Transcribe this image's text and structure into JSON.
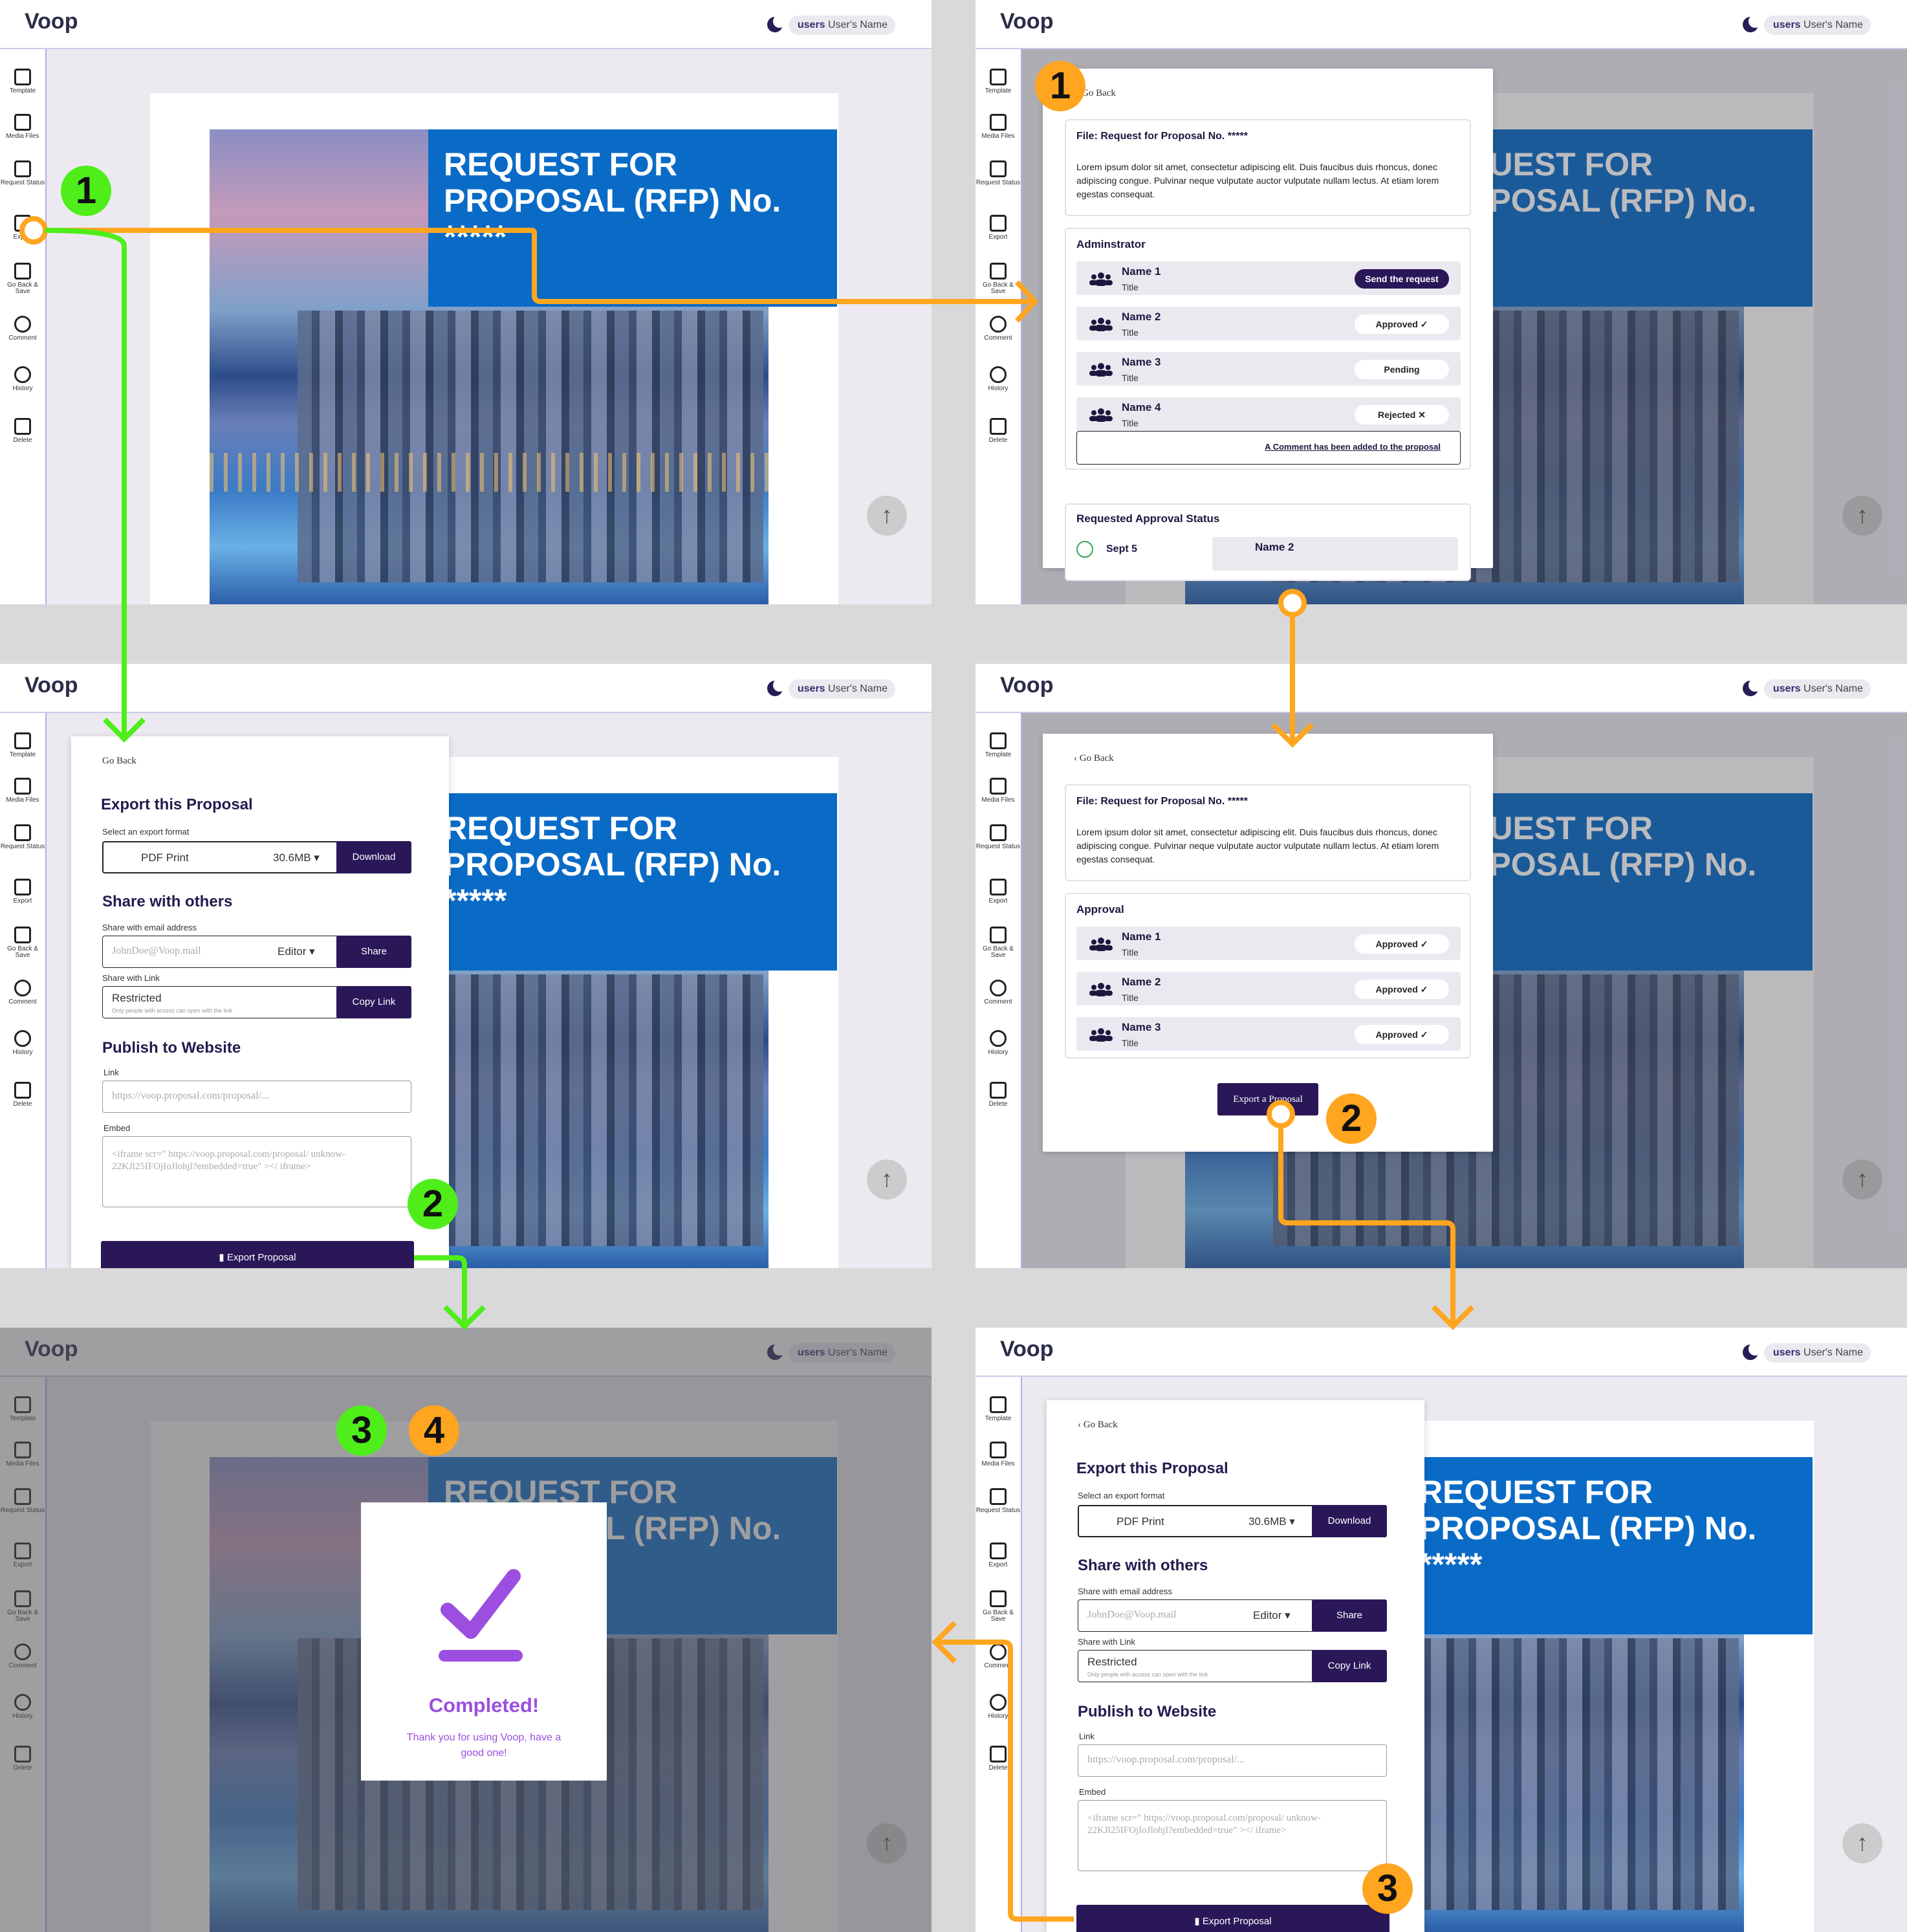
{
  "app": {
    "logo": "Voop",
    "user_prefix": "users",
    "user_name": "User's Name"
  },
  "sidebar": [
    "Template",
    "Media Files",
    "Request Status",
    "Export",
    "Go Back & Save",
    "Comment",
    "History",
    "Delete"
  ],
  "document": {
    "title": "REQUEST FOR PROPOSAL (RFP) No. *****",
    "title_partial": "UEST FOR POSAL (RFP) ****"
  },
  "request_status": {
    "go_back": "Go Back",
    "file_title": "File: Request for Proposal No. *****",
    "lorem": "Lorem ipsum dolor sit amet, consectetur adipiscing elit. Duis faucibus duis rhoncus, donec adipiscing congue. Pulvinar neque vulputate auctor vulputate nullam lectus. At etiam lorem egestas consequat.",
    "admin_heading": "Adminstrator",
    "rows": [
      {
        "name": "Name 1",
        "title": "Title",
        "status": "Send the request"
      },
      {
        "name": "Name 2",
        "title": "Title",
        "status": "Approved ✓"
      },
      {
        "name": "Name 3",
        "title": "Title",
        "status": "Pending"
      },
      {
        "name": "Name 4",
        "title": "Title",
        "status": "Rejected ✕"
      }
    ],
    "comment_link": "A Comment has been added to the proposal",
    "approval_status_heading": "Requested Approval Status",
    "approval_date": "Sept 5",
    "approval_name": "Name 2"
  },
  "approval": {
    "heading": "Approval",
    "rows": [
      {
        "name": "Name 1",
        "title": "Title",
        "status": "Approved ✓"
      },
      {
        "name": "Name 2",
        "title": "Title",
        "status": "Approved ✓"
      },
      {
        "name": "Name 3",
        "title": "Title",
        "status": "Approved ✓"
      }
    ],
    "export_button": "Export a Proposal"
  },
  "export": {
    "go_back": "Go Back",
    "heading": "Export this Proposal",
    "format_label": "Select an export format",
    "format": "PDF Print",
    "size": "30.6MB ▾",
    "download": "Download",
    "share_heading": "Share with others",
    "email_label": "Share with email address",
    "email_placeholder": "JohnDoe@Voop.mail",
    "role": "Editor ▾",
    "share": "Share",
    "link_label": "Share with Link",
    "restricted": "Restricted",
    "restricted_note": "Only people with access can open with the link",
    "copy_link": "Copy Link",
    "publish_heading": "Publish to Website",
    "link_field_label": "Link",
    "link_placeholder": "https://voop.proposal.com/proposal/...",
    "embed_label": "Embed",
    "embed_placeholder": "<iframe scr=\" https://voop.proposal.com/proposal/ unknow-22KJl25IFOjIoJlohjl?embedded=true\" ></ iframe>",
    "export_button": "Export Proposal"
  },
  "completed": {
    "title": "Completed!",
    "message": "Thank you for using Voop, have a good one!"
  },
  "badges": {
    "g1": "1",
    "o1": "1",
    "g2": "2",
    "o2": "2",
    "g3": "3",
    "o4": "4",
    "o3": "3"
  },
  "colors": {
    "green": "#4fee1a",
    "orange": "#ffa51f",
    "brand_dark": "#2a1758",
    "purple": "#9b4ee0",
    "doc_blue": "#0a6bc7"
  }
}
